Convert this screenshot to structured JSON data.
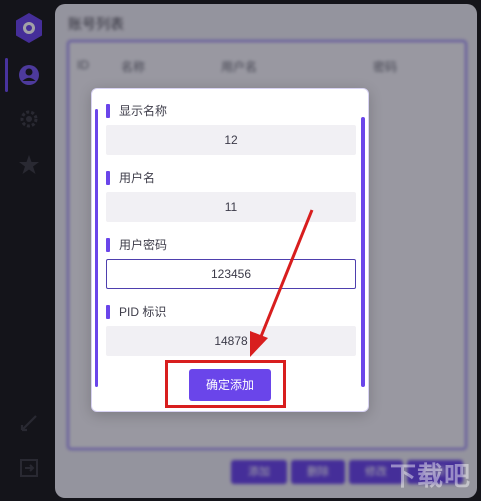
{
  "window": {
    "title": "账号列表"
  },
  "table": {
    "headers": [
      "ID",
      "名称",
      "用户名",
      "密码"
    ]
  },
  "bottom_buttons": [
    "添加",
    "删除",
    "修改",
    "刷新"
  ],
  "dialog": {
    "fields": [
      {
        "label": "显示名称",
        "value": "12"
      },
      {
        "label": "用户名",
        "value": "11"
      },
      {
        "label": "用户密码",
        "value": "123456"
      },
      {
        "label": "PID 标识",
        "value": "14878"
      }
    ],
    "confirm_label": "确定添加"
  },
  "watermark": "下载吧",
  "colors": {
    "accent": "#6a45ea",
    "annotation": "#d81e1e"
  },
  "icons": [
    "app-logo-icon",
    "user-icon",
    "gear-icon",
    "star-icon",
    "collapse-icon",
    "exit-icon"
  ]
}
